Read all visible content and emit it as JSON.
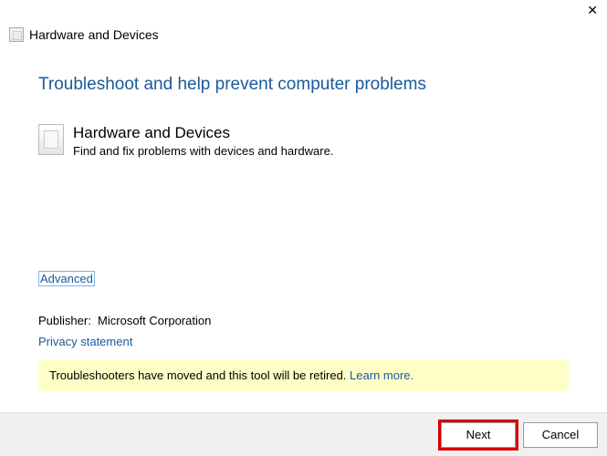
{
  "close_symbol": "✕",
  "header": {
    "title": "Hardware and Devices"
  },
  "main": {
    "heading": "Troubleshoot and help prevent computer problems",
    "section_title": "Hardware and Devices",
    "section_desc": "Find and fix problems with devices and hardware."
  },
  "links": {
    "advanced": "Advanced",
    "privacy": "Privacy statement",
    "learn_more": "Learn more."
  },
  "publisher": {
    "label": "Publisher:",
    "value": "Microsoft Corporation"
  },
  "banner": {
    "text": "Troubleshooters have moved and this tool will be retired."
  },
  "buttons": {
    "next": "Next",
    "cancel": "Cancel"
  }
}
